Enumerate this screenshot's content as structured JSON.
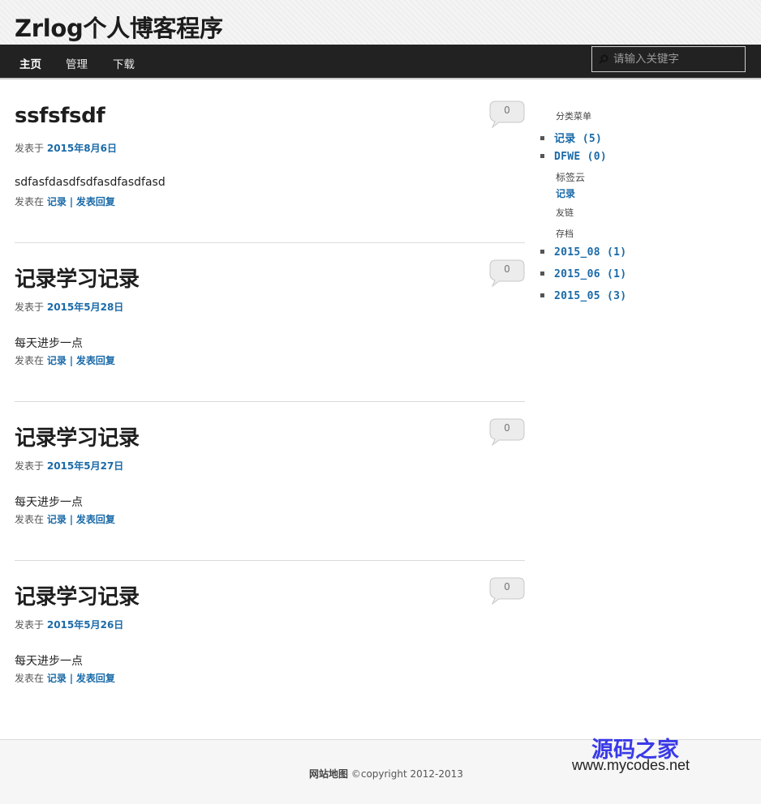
{
  "site": {
    "title": "Zrlog个人博客程序"
  },
  "nav": {
    "items": [
      {
        "label": "主页",
        "active": true
      },
      {
        "label": "管理",
        "active": false
      },
      {
        "label": "下载",
        "active": false
      }
    ],
    "search_placeholder": "请输入关键字"
  },
  "posts": [
    {
      "title": "ssfsfsdf",
      "meta_prefix": "发表于",
      "date": "2015年8月6日",
      "body": "sdfasfdasdfsdfasdfasdfasd",
      "foot_prefix": "发表在",
      "category": "记录",
      "separator": "|",
      "reply_label": "发表回复",
      "comments": "0"
    },
    {
      "title": "记录学习记录",
      "meta_prefix": "发表于",
      "date": "2015年5月28日",
      "body": "每天进步一点",
      "foot_prefix": "发表在",
      "category": "记录",
      "separator": "|",
      "reply_label": "发表回复",
      "comments": "0"
    },
    {
      "title": "记录学习记录",
      "meta_prefix": "发表于",
      "date": "2015年5月27日",
      "body": "每天进步一点",
      "foot_prefix": "发表在",
      "category": "记录",
      "separator": "|",
      "reply_label": "发表回复",
      "comments": "0"
    },
    {
      "title": "记录学习记录",
      "meta_prefix": "发表于",
      "date": "2015年5月26日",
      "body": "每天进步一点",
      "foot_prefix": "发表在",
      "category": "记录",
      "separator": "|",
      "reply_label": "发表回复",
      "comments": "0"
    }
  ],
  "sidebar": {
    "categories_heading": "分类菜单",
    "categories": [
      "记录 (5)",
      "DFWE (0)"
    ],
    "tags_heading": "标签云",
    "tags": [
      "记录"
    ],
    "links_heading": "友链",
    "archive_heading": "存档",
    "archives": [
      "2015_08 (1)",
      "2015_06 (1)",
      "2015_05 (3)"
    ]
  },
  "footer": {
    "sitemap_label": "网站地图",
    "copyright": "©copyright 2012-2013",
    "watermark_cn": "源码之家",
    "watermark_url": "www.mycodes.net"
  },
  "colors": {
    "link": "#1a6aa8",
    "nav_bg": "#222222",
    "watermark": "#3a3ae8"
  }
}
